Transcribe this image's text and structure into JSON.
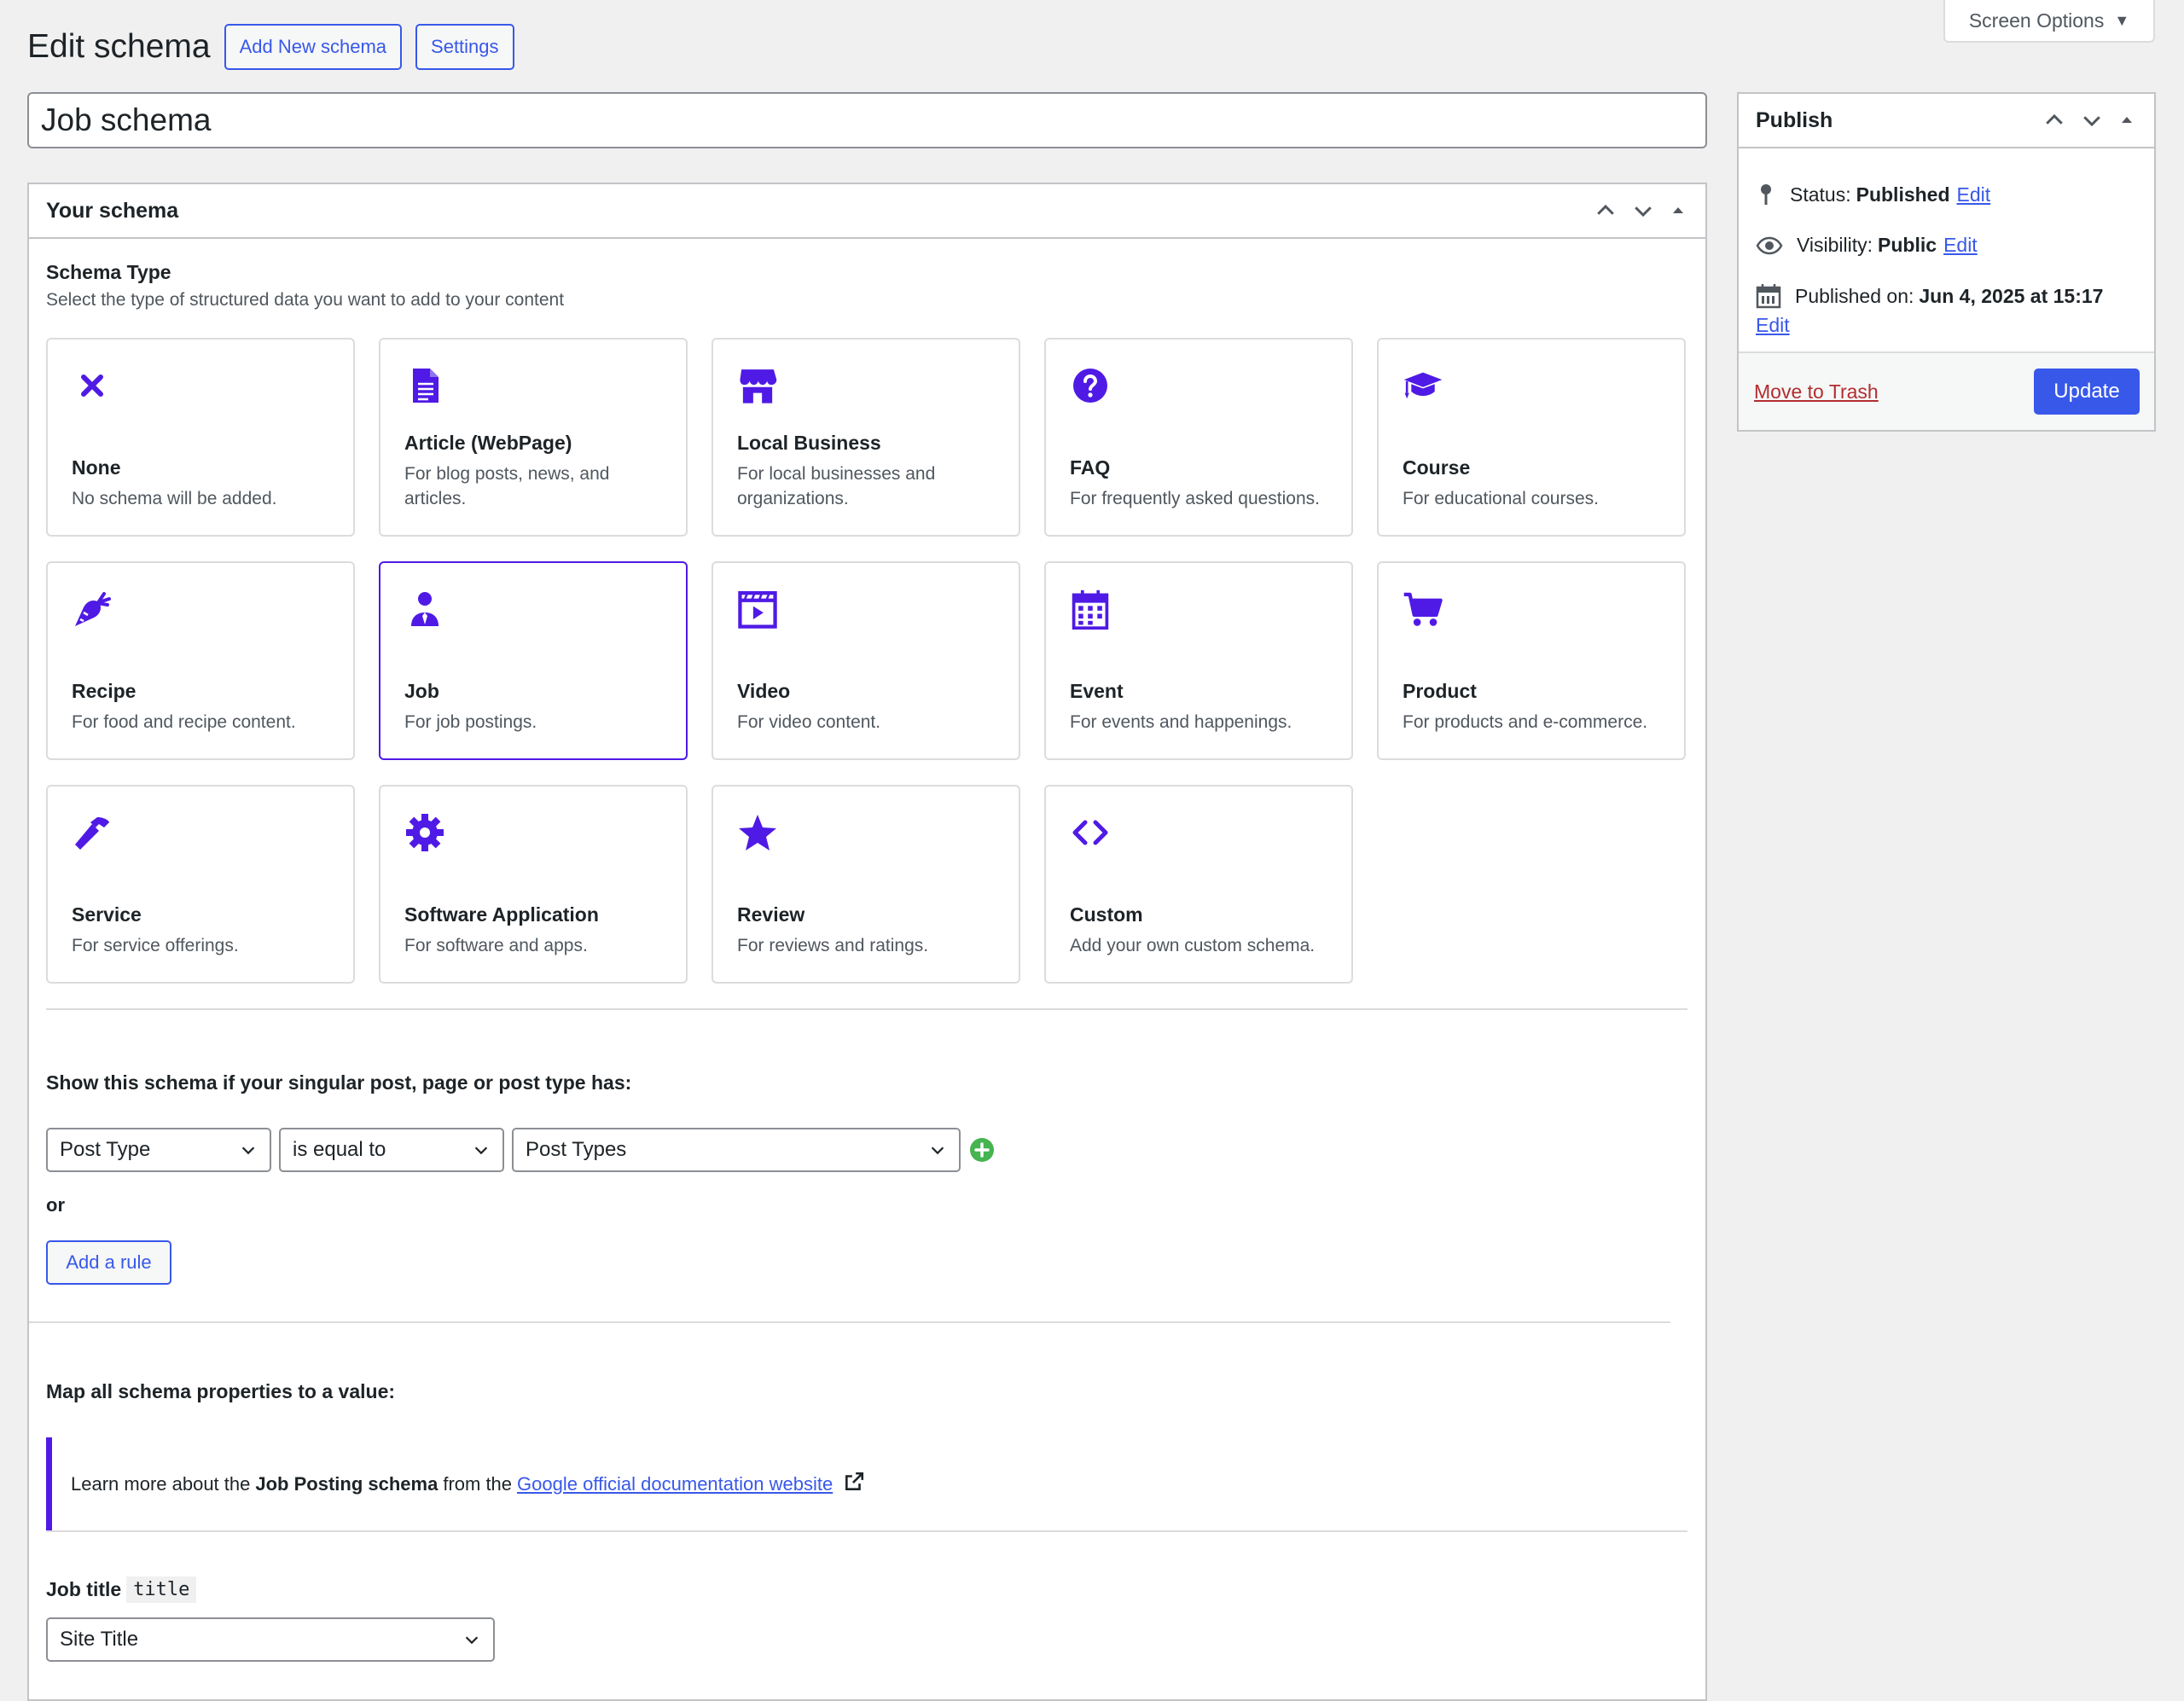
{
  "header": {
    "title": "Edit schema",
    "add_new_label": "Add New schema",
    "settings_label": "Settings",
    "screen_options_label": "Screen Options"
  },
  "post_title": "Job schema",
  "schema_box": {
    "title": "Your schema",
    "type_label": "Schema Type",
    "type_description": "Select the type of structured data you want to add to your content",
    "cards": [
      {
        "name": "None",
        "desc": "No schema will be added.",
        "icon": "close-icon"
      },
      {
        "name": "Article (WebPage)",
        "desc": "For blog posts, news, and articles.",
        "icon": "document-icon"
      },
      {
        "name": "Local Business",
        "desc": "For local businesses and organizations.",
        "icon": "store-icon"
      },
      {
        "name": "FAQ",
        "desc": "For frequently asked questions.",
        "icon": "question-icon"
      },
      {
        "name": "Course",
        "desc": "For educational courses.",
        "icon": "graduation-cap-icon"
      },
      {
        "name": "Recipe",
        "desc": "For food and recipe content.",
        "icon": "carrot-icon"
      },
      {
        "name": "Job",
        "desc": "For job postings.",
        "icon": "user-tie-icon",
        "selected": true
      },
      {
        "name": "Video",
        "desc": "For video content.",
        "icon": "video-icon"
      },
      {
        "name": "Event",
        "desc": "For events and happenings.",
        "icon": "calendar-icon"
      },
      {
        "name": "Product",
        "desc": "For products and e-commerce.",
        "icon": "cart-icon"
      },
      {
        "name": "Service",
        "desc": "For service offerings.",
        "icon": "hammer-icon"
      },
      {
        "name": "Software Application",
        "desc": "For software and apps.",
        "icon": "gear-icon"
      },
      {
        "name": "Review",
        "desc": "For reviews and ratings.",
        "icon": "star-icon"
      },
      {
        "name": "Custom",
        "desc": "Add your own custom schema.",
        "icon": "code-icon"
      }
    ],
    "rules_label": "Show this schema if your singular post, page or post type has:",
    "rule": {
      "param": "Post Type",
      "operator": "is equal to",
      "value": "Post Types"
    },
    "or_label": "or",
    "add_rule_label": "Add a rule",
    "map_label": "Map all schema properties to a value:",
    "notice": {
      "prefix": "Learn more about the",
      "schema_name": "Job Posting schema",
      "middle": "from the",
      "link_text": "Google official documentation website"
    },
    "job_title": {
      "label": "Job title",
      "code": "title",
      "value": "Site Title"
    }
  },
  "publish": {
    "title": "Publish",
    "status_label": "Status:",
    "status_value": "Published",
    "visibility_label": "Visibility:",
    "visibility_value": "Public",
    "published_label": "Published on:",
    "published_value": "Jun 4, 2025 at 15:17",
    "edit_label": "Edit",
    "trash_label": "Move to Trash",
    "update_label": "Update"
  },
  "colors": {
    "accent": "#4f1ae5",
    "link": "#3858e9",
    "trash": "#b32d2e",
    "success": "#46b450"
  }
}
